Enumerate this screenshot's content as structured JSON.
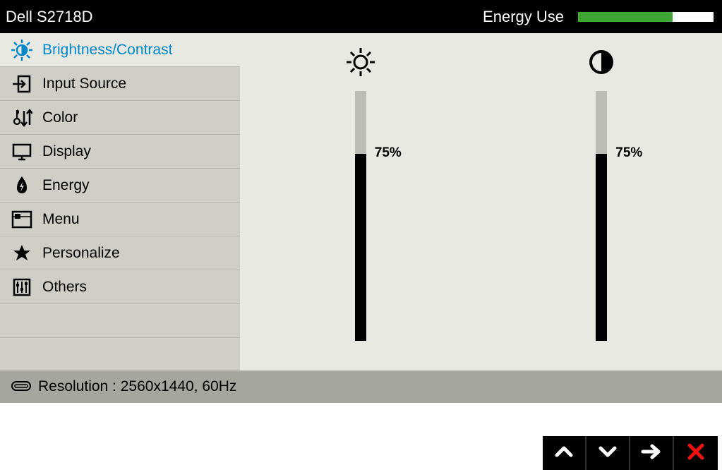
{
  "header": {
    "model": "Dell S2718D",
    "energy_label": "Energy Use",
    "energy_percent": 70
  },
  "menu": [
    {
      "id": "brightness-contrast",
      "label": "Brightness/Contrast",
      "active": true
    },
    {
      "id": "input-source",
      "label": "Input Source",
      "active": false
    },
    {
      "id": "color",
      "label": "Color",
      "active": false
    },
    {
      "id": "display",
      "label": "Display",
      "active": false
    },
    {
      "id": "energy",
      "label": "Energy",
      "active": false
    },
    {
      "id": "menu",
      "label": "Menu",
      "active": false
    },
    {
      "id": "personalize",
      "label": "Personalize",
      "active": false
    },
    {
      "id": "others",
      "label": "Others",
      "active": false
    }
  ],
  "sliders": {
    "brightness": {
      "value": 75,
      "display": "75%"
    },
    "contrast": {
      "value": 75,
      "display": "75%"
    }
  },
  "footer": {
    "resolution": "Resolution : 2560x1440, 60Hz"
  },
  "nav": {
    "up": "up",
    "down": "down",
    "next": "next",
    "close": "close"
  }
}
